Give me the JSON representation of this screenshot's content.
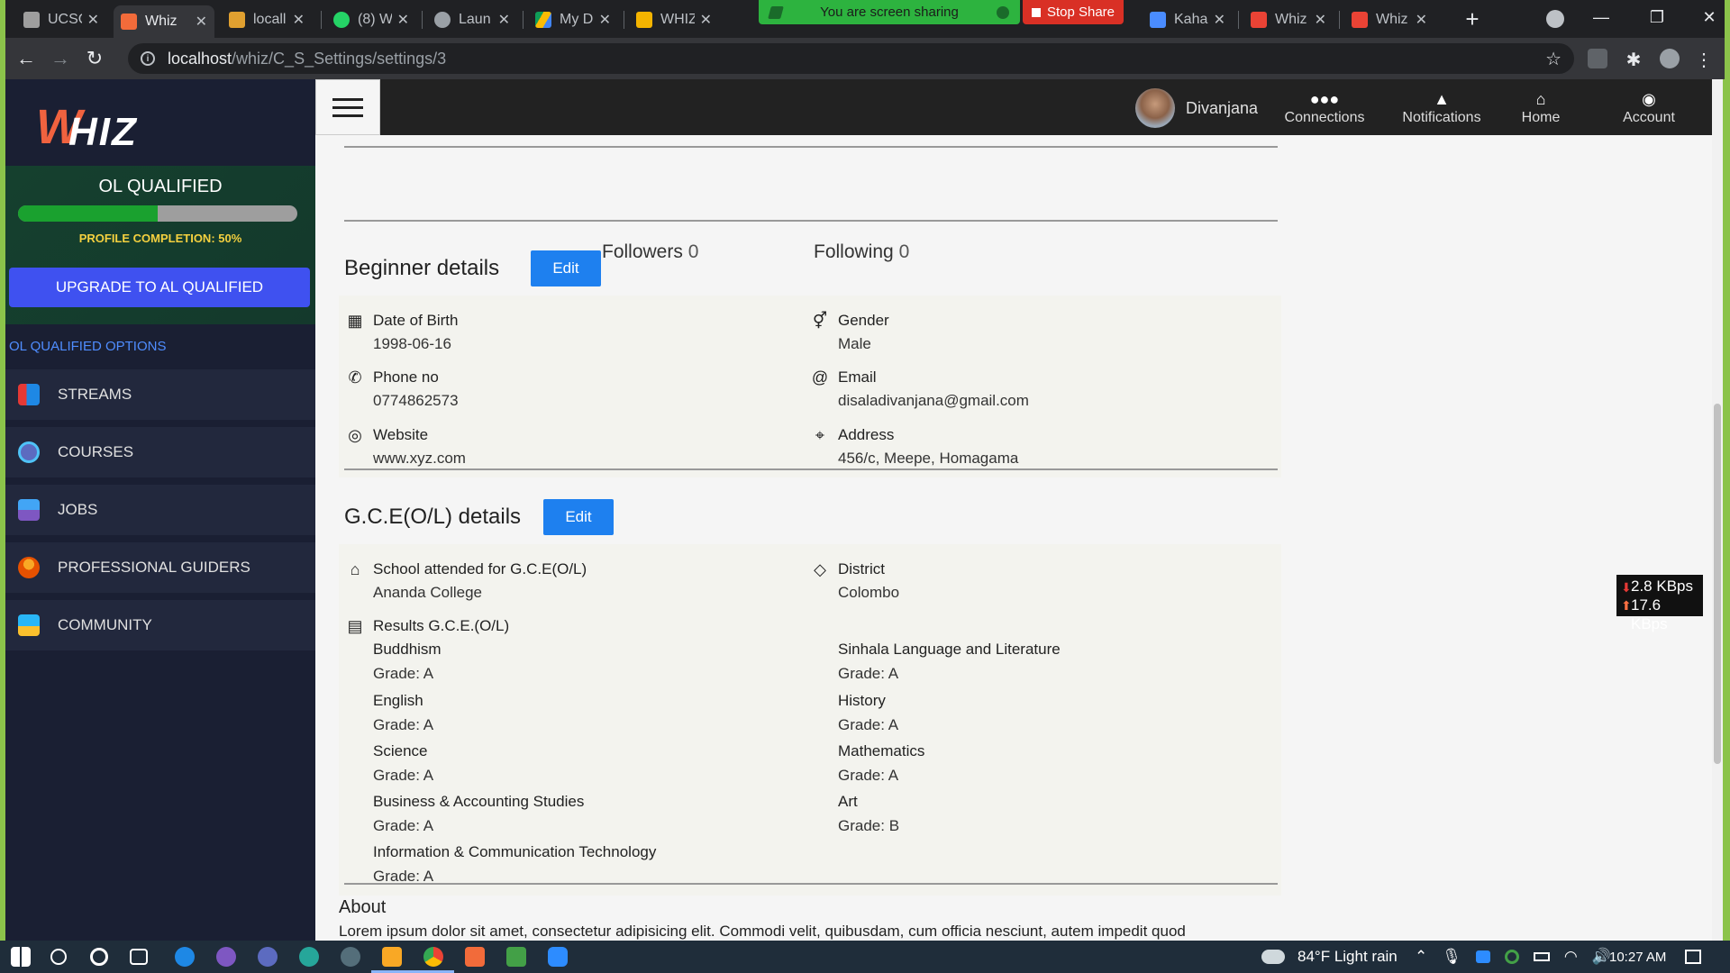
{
  "browser": {
    "tabs": [
      {
        "label": "UCSC",
        "color": "#9e9e9e",
        "active": false
      },
      {
        "label": "Whiz",
        "color": "#f26b3a",
        "active": true
      },
      {
        "label": "locall",
        "color": "#e0a030",
        "active": false
      },
      {
        "label": "(8) W",
        "color": "#25d366",
        "active": false
      },
      {
        "label": "Laun",
        "color": "#9aa0a6",
        "active": false
      },
      {
        "label": "My D",
        "color": "#fbbc04",
        "active": false
      },
      {
        "label": "WHIZ",
        "color": "#f4b400",
        "active": false
      },
      {
        "label": "Kaha",
        "color": "#4a8cff",
        "active": false
      },
      {
        "label": "Whiz",
        "color": "#ea4335",
        "active": false
      },
      {
        "label": "Whiz",
        "color": "#ea4335",
        "active": false
      }
    ],
    "share_banner": "You are screen sharing",
    "stop_share": "Stop Share",
    "url_host": "localhost",
    "url_path": "/whiz/C_S_Settings/settings/3"
  },
  "sidebar": {
    "logo_w": "W",
    "logo_text": "HIZ",
    "qualification": "OL QUALIFIED",
    "progress_fraction": 0.5,
    "completion_label": "PROFILE COMPLETION: 50%",
    "upgrade_label": "UPGRADE TO AL QUALIFIED",
    "options_title": "OL QUALIFIED OPTIONS",
    "items": [
      {
        "label": "STREAMS",
        "icon": "streams-icon",
        "color": "#e53935"
      },
      {
        "label": "COURSES",
        "icon": "courses-icon",
        "color": "#5c6bc0"
      },
      {
        "label": "JOBS",
        "icon": "jobs-icon",
        "color": "#42a5f5"
      },
      {
        "label": "PROFESSIONAL GUIDERS",
        "icon": "guiders-icon",
        "color": "#f9a825"
      },
      {
        "label": "COMMUNITY",
        "icon": "community-icon",
        "color": "#29b6f6"
      }
    ]
  },
  "header": {
    "username": "Divanjana",
    "nav": [
      {
        "label": "Connections",
        "icon": "connections-icon"
      },
      {
        "label": "Notifications",
        "icon": "bell-icon"
      },
      {
        "label": "Home",
        "icon": "home-icon"
      },
      {
        "label": "Account",
        "icon": "account-icon"
      }
    ]
  },
  "profile": {
    "followers_label": "Followers",
    "followers_count": "0",
    "following_label": "Following",
    "following_count": "0",
    "beginner": {
      "title": "Beginner details",
      "edit": "Edit",
      "dob_label": "Date of Birth",
      "dob": "1998-06-16",
      "gender_label": "Gender",
      "gender": "Male",
      "phone_label": "Phone no",
      "phone": "0774862573",
      "email_label": "Email",
      "email": "disaladivanjana@gmail.com",
      "website_label": "Website",
      "website": "www.xyz.com",
      "address_label": "Address",
      "address": "456/c, Meepe, Homagama"
    },
    "gce": {
      "title": "G.C.E(O/L) details",
      "edit": "Edit",
      "school_label": "School attended for G.C.E(O/L)",
      "school": "Ananda College",
      "district_label": "District",
      "district": "Colombo",
      "results_label": "Results G.C.E.(O/L)",
      "results_left": [
        {
          "subject": "Buddhism",
          "grade": "Grade: A"
        },
        {
          "subject": "English",
          "grade": "Grade: A"
        },
        {
          "subject": "Science",
          "grade": "Grade: A"
        },
        {
          "subject": "Business & Accounting Studies",
          "grade": "Grade: A"
        },
        {
          "subject": "Information & Communication Technology",
          "grade": "Grade: A"
        }
      ],
      "results_right": [
        {
          "subject": "Sinhala Language and Literature",
          "grade": "Grade: A"
        },
        {
          "subject": "History",
          "grade": "Grade: A"
        },
        {
          "subject": "Mathematics",
          "grade": "Grade: A"
        },
        {
          "subject": "Art",
          "grade": "Grade: B"
        }
      ]
    },
    "about_title": "About",
    "about_text": "Lorem ipsum dolor sit amet, consectetur adipisicing elit. Commodi velit, quibusdam, cum officia nesciunt, autem impedit quod"
  },
  "netspeed": {
    "down": "2.8 KBps",
    "up": "17.6 KBps"
  },
  "taskbar": {
    "weather": "84°F  Light rain",
    "time": "10:27 AM"
  }
}
